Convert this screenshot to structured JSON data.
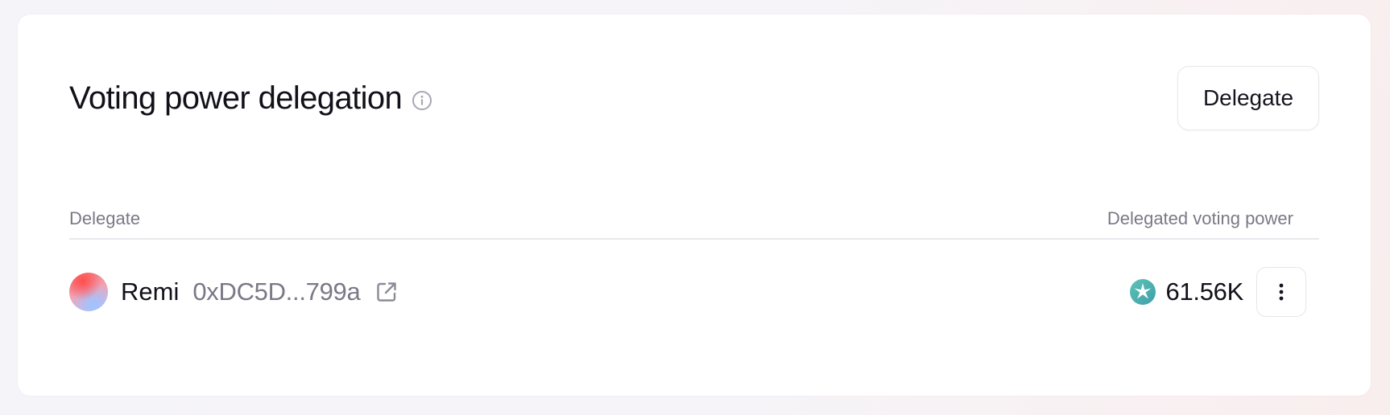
{
  "header": {
    "title": "Voting power delegation",
    "info_icon": "info-icon",
    "delegate_button_label": "Delegate"
  },
  "table": {
    "columns": [
      "Delegate",
      "Delegated voting power"
    ],
    "rows": [
      {
        "name": "Remi",
        "address": "0xDC5D...799a",
        "link_icon": "external-link-icon",
        "token_icon": "token-star-icon",
        "voting_power": "61.56K",
        "menu_icon": "more-vertical-icon"
      }
    ]
  },
  "colors": {
    "background": "#f5f4f8",
    "card": "#ffffff",
    "text_primary": "#121019",
    "text_muted": "#7b7887",
    "border": "#e7e6ec",
    "token_teal": "#4fb3b0"
  }
}
